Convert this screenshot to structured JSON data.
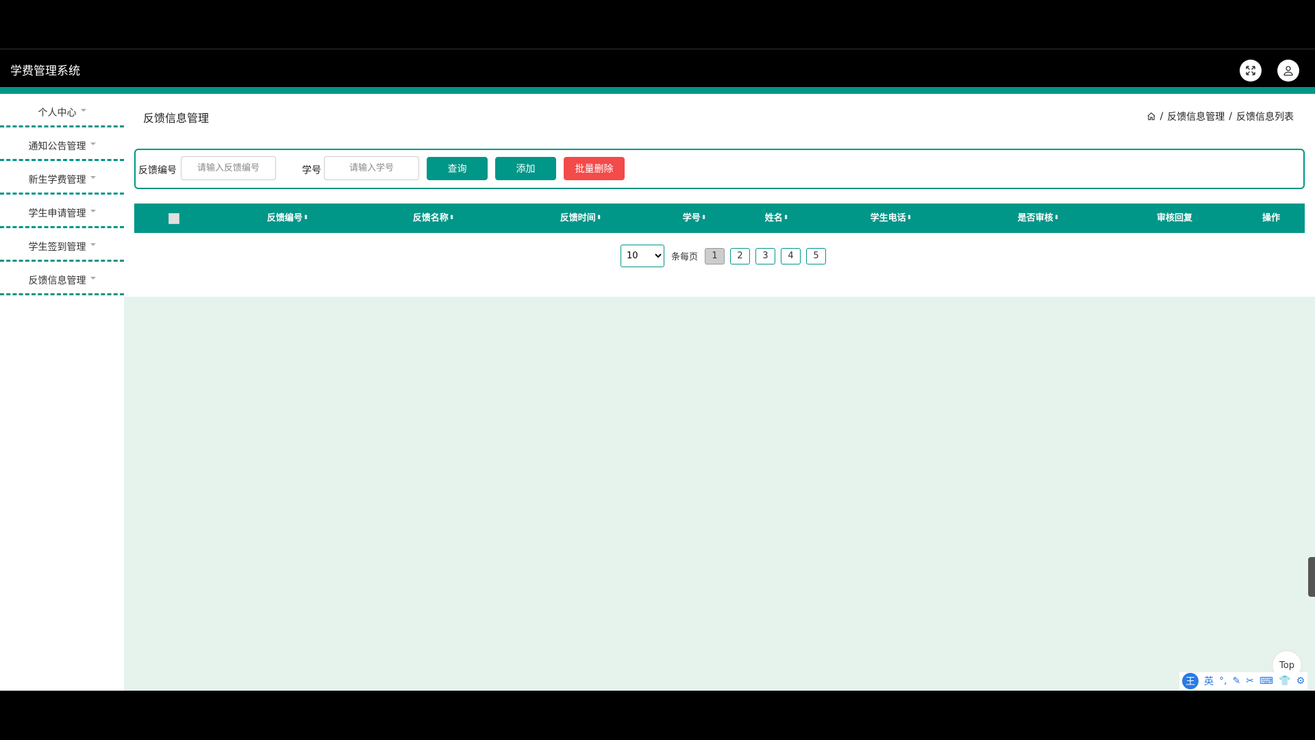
{
  "app": {
    "title": "学费管理系统"
  },
  "header": {
    "fullscreen_icon": "expand-icon",
    "user_icon": "user-icon"
  },
  "sidebar": {
    "items": [
      {
        "label": "个人中心"
      },
      {
        "label": "通知公告管理"
      },
      {
        "label": "新生学费管理"
      },
      {
        "label": "学生申请管理"
      },
      {
        "label": "学生签到管理"
      },
      {
        "label": "反馈信息管理"
      }
    ]
  },
  "page": {
    "title": "反馈信息管理"
  },
  "breadcrumb": {
    "home_icon": "home-icon",
    "level1": "反馈信息管理",
    "level2": "反馈信息列表",
    "separator": "/"
  },
  "search": {
    "feedback_no_label": "反馈编号",
    "feedback_no_placeholder": "请输入反馈编号",
    "student_no_label": "学号",
    "student_no_placeholder": "请输入学号",
    "query_label": "查询",
    "add_label": "添加",
    "batch_delete_label": "批量删除"
  },
  "table": {
    "columns": [
      "反馈编号",
      "反馈名称",
      "反馈时间",
      "学号",
      "姓名",
      "学生电话",
      "是否审核",
      "审核回复",
      "操作"
    ],
    "sort_glyph": "⬍"
  },
  "pager": {
    "page_size": "10",
    "per_page_text": "条每页",
    "pages": [
      "1",
      "2",
      "3",
      "4",
      "5"
    ],
    "current": "1"
  },
  "misc": {
    "top_label": "Top",
    "ime_badge": "王",
    "ime_lang": "英"
  },
  "colors": {
    "accent": "#009688",
    "danger": "#f34a4a",
    "content_bg": "#e6f3ec"
  }
}
